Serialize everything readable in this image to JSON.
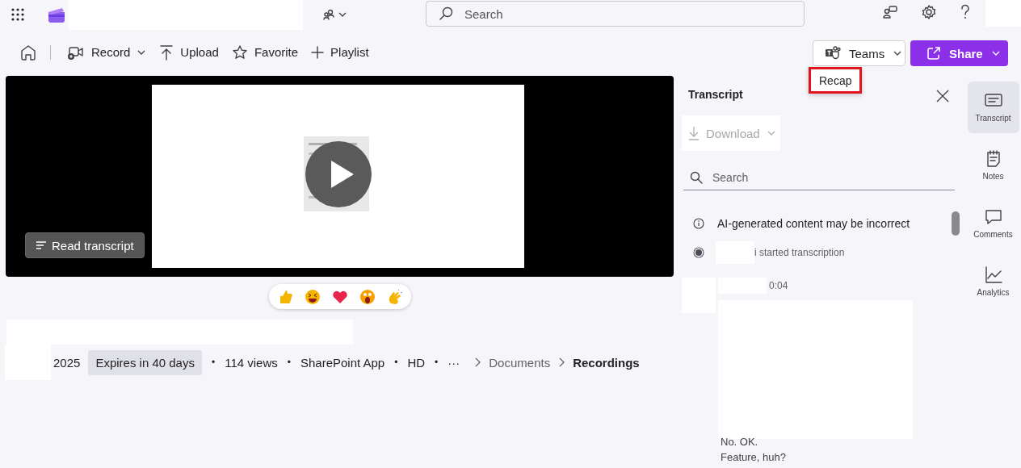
{
  "header": {
    "search_placeholder": "Search"
  },
  "toolbar": {
    "items": [
      {
        "label": "Record",
        "dropdown": true
      },
      {
        "label": "Upload",
        "dropdown": false
      },
      {
        "label": "Favorite",
        "dropdown": false
      },
      {
        "label": "Playlist",
        "dropdown": false
      }
    ],
    "teams": "Teams",
    "share": "Share",
    "menu": [
      {
        "label": "Recap",
        "highlighted": true
      }
    ]
  },
  "player": {
    "read_transcript": "Read transcript"
  },
  "info": {
    "date": "2025",
    "badge": "Expires in 40 days",
    "meta": [
      "114 views",
      "SharePoint App",
      "HD"
    ],
    "separator": "•",
    "more": "···",
    "breadcrumb": [
      {
        "label": "Documents",
        "current": false
      },
      {
        "label": "Recordings",
        "current": true
      }
    ]
  },
  "transcript": {
    "title": "Transcript",
    "download": {
      "label": "Download",
      "disabled": true
    },
    "search_placeholder": "Search",
    "notice": "AI-generated content may be incorrect",
    "event": "i started transcription",
    "timestamp": "0:04",
    "lines": [
      "No. OK.",
      "Feature, huh?"
    ]
  },
  "rail": [
    {
      "label": "Transcript",
      "selected": true
    },
    {
      "label": "Notes",
      "selected": false
    },
    {
      "label": "Comments",
      "selected": false
    },
    {
      "label": "Analytics",
      "selected": false
    }
  ]
}
